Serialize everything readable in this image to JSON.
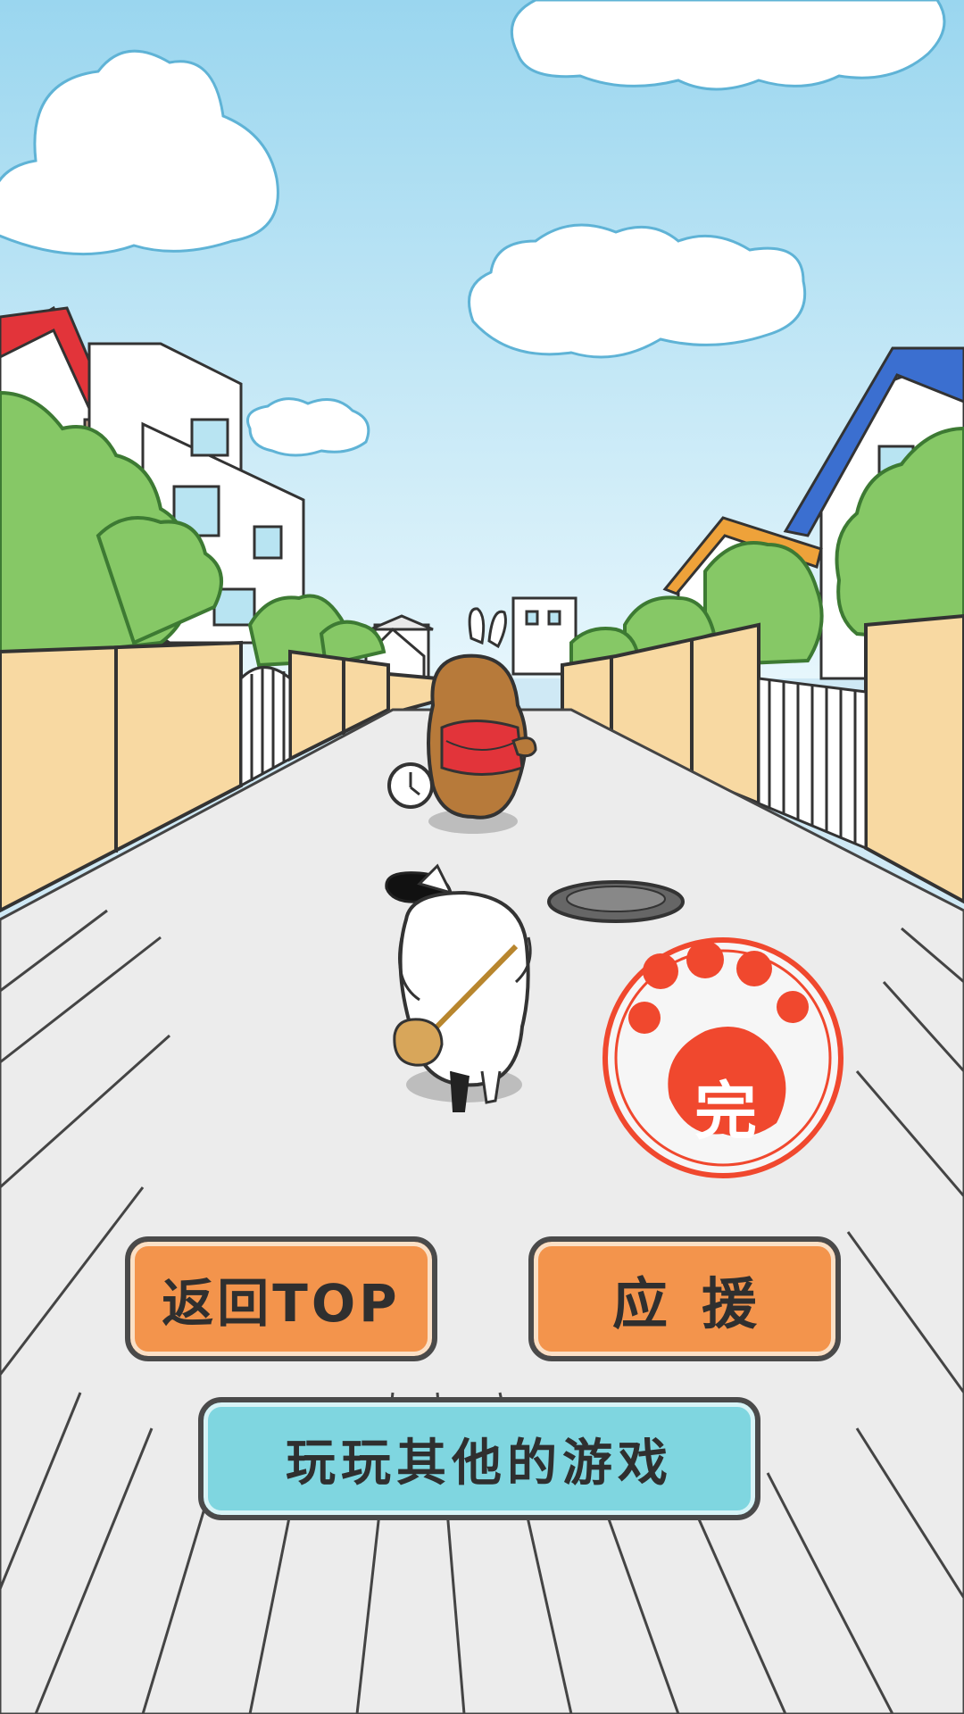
{
  "buttons": {
    "back_to_top": "返回TOP",
    "cheer": "应援",
    "play_other_games": "玩玩其他的游戏"
  },
  "stamp": {
    "text": "完"
  },
  "colors": {
    "sky_top": "#a9def2",
    "sky_bottom": "#e8f7fd",
    "road": "#ececec",
    "wall": "#f8d9a2",
    "orange_button": "#f3944c",
    "cyan_button": "#7fd6e0",
    "stamp_red": "#f0482e",
    "roof_red": "#e2343a",
    "roof_blue": "#3b6fd0",
    "roof_orange": "#eea23a",
    "tree_green": "#86c866"
  }
}
